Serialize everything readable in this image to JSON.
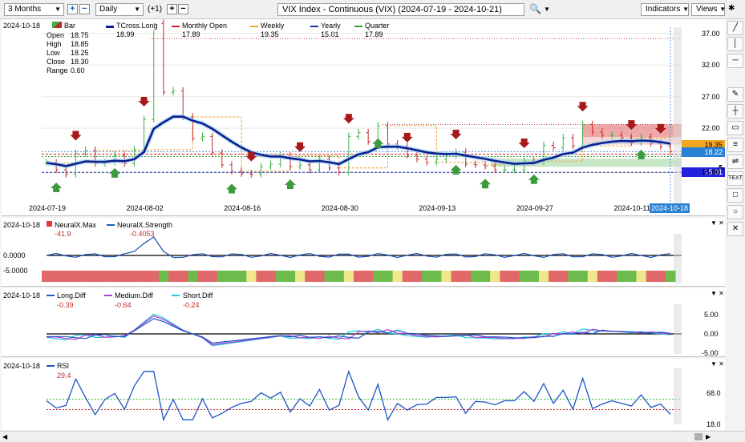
{
  "toolbar": {
    "range": "3 Months",
    "interval": "Daily",
    "plus_one": "(+1)",
    "title": "VIX Index - Continuous (VIX) (2024-07-19 - 2024-10-21)",
    "indicators_label": "Indicators",
    "views_label": "Views"
  },
  "main_panel": {
    "date": "2024-10-18",
    "bar_label": "Bar",
    "ohlc": [
      {
        "k": "Open",
        "v": "18.75"
      },
      {
        "k": "High",
        "v": "18.85"
      },
      {
        "k": "Low",
        "v": "18.25"
      },
      {
        "k": "Close",
        "v": "18.30"
      },
      {
        "k": "Range",
        "v": "0.60"
      }
    ],
    "legend": [
      {
        "name": "TCross.Long",
        "value": "18.99",
        "color": "#0a1f8f"
      },
      {
        "name": "Monthly Open",
        "value": "17.89",
        "color": "#d42020"
      },
      {
        "name": "Weekly",
        "value": "19.35",
        "color": "#f0a030"
      },
      {
        "name": "Yearly",
        "value": "15.01",
        "color": "#1a2a9a"
      },
      {
        "name": "Quarter",
        "value": "17.89",
        "color": "#30a030"
      }
    ],
    "price_ticks": [
      "37.00",
      "32.00",
      "27.00",
      "22.00",
      "15.00"
    ],
    "price_tags": [
      {
        "text": "19.35",
        "bg": "#f5a623"
      },
      {
        "text": "18.22",
        "bg": "#2a82d6"
      },
      {
        "text": "15.01",
        "bg": "#2222dd"
      }
    ],
    "dates": [
      "2024-07-19",
      "2024-08-02",
      "2024-08-16",
      "2024-08-30",
      "2024-09-13",
      "2024-09-27",
      "2024-10-11",
      "2024-10-18"
    ]
  },
  "neural_panel": {
    "date": "2024-10-18",
    "max_name": "NeuralX.Max",
    "max_value": "-41.9",
    "strength_name": "NeuralX.Strength",
    "strength_value": "-0.4053",
    "ticks": [
      "0.0000",
      "-5.0000"
    ]
  },
  "diff_panel": {
    "date": "2024-10-18",
    "long_name": "Long.Diff",
    "long_value": "-0.39",
    "medium_name": "Medium.Diff",
    "medium_value": "-0.64",
    "short_name": "Short.Diff",
    "short_value": "-0.24",
    "ticks": [
      "5.00",
      "0.00",
      "-5.00"
    ]
  },
  "rsi_panel": {
    "date": "2024-10-18",
    "name": "RSI",
    "value": "29.4",
    "ticks": [
      "68.0",
      "18.0"
    ]
  },
  "chart_data": [
    {
      "type": "candlestick",
      "title": "VIX Index - Continuous (VIX)",
      "x": [
        "2024-07-19",
        "2024-07-22",
        "2024-07-23",
        "2024-07-24",
        "2024-07-25",
        "2024-07-26",
        "2024-07-29",
        "2024-07-30",
        "2024-07-31",
        "2024-08-01",
        "2024-08-02",
        "2024-08-05",
        "2024-08-06",
        "2024-08-07",
        "2024-08-08",
        "2024-08-09",
        "2024-08-12",
        "2024-08-13",
        "2024-08-14",
        "2024-08-15",
        "2024-08-16",
        "2024-08-19",
        "2024-08-20",
        "2024-08-21",
        "2024-08-22",
        "2024-08-23",
        "2024-08-26",
        "2024-08-27",
        "2024-08-28",
        "2024-08-29",
        "2024-08-30",
        "2024-09-03",
        "2024-09-04",
        "2024-09-05",
        "2024-09-06",
        "2024-09-09",
        "2024-09-10",
        "2024-09-11",
        "2024-09-12",
        "2024-09-13",
        "2024-09-16",
        "2024-09-17",
        "2024-09-18",
        "2024-09-19",
        "2024-09-20",
        "2024-09-23",
        "2024-09-24",
        "2024-09-25",
        "2024-09-26",
        "2024-09-27",
        "2024-09-30",
        "2024-10-01",
        "2024-10-02",
        "2024-10-03",
        "2024-10-04",
        "2024-10-07",
        "2024-10-08",
        "2024-10-09",
        "2024-10-10",
        "2024-10-11",
        "2024-10-14",
        "2024-10-15",
        "2024-10-16",
        "2024-10-17",
        "2024-10-18"
      ],
      "close": [
        16.5,
        15.4,
        14.7,
        18.0,
        18.5,
        16.4,
        16.6,
        17.7,
        16.4,
        18.6,
        23.4,
        38.6,
        27.7,
        27.9,
        23.8,
        20.4,
        20.7,
        18.1,
        16.2,
        15.2,
        14.8,
        14.7,
        15.9,
        16.3,
        17.6,
        15.9,
        16.2,
        15.4,
        17.1,
        15.7,
        15.0,
        20.7,
        21.3,
        19.9,
        22.4,
        19.5,
        19.1,
        17.7,
        17.1,
        16.6,
        17.1,
        17.6,
        18.2,
        16.3,
        16.2,
        16.0,
        15.4,
        15.4,
        15.4,
        16.8,
        16.7,
        19.3,
        18.9,
        20.5,
        19.2,
        22.6,
        21.4,
        20.9,
        20.9,
        20.5,
        19.7,
        20.6,
        19.6,
        19.1,
        18.3
      ],
      "overlays": {
        "Monthly Open": 17.89,
        "Weekly": 19.35,
        "Yearly": 15.01,
        "Quarter": 17.89,
        "TCross.Long_last": 18.99
      },
      "ylim": [
        12,
        38
      ]
    },
    {
      "type": "line",
      "series": [
        {
          "name": "NeuralX.Strength",
          "last": -0.4053
        }
      ],
      "summary": {
        "NeuralX.Max": -41.9
      },
      "ylim": [
        -7,
        6
      ]
    },
    {
      "type": "line",
      "series": [
        {
          "name": "Long.Diff",
          "last": -0.39
        },
        {
          "name": "Medium.Diff",
          "last": -0.64
        },
        {
          "name": "Short.Diff",
          "last": -0.24
        }
      ],
      "ylim": [
        -5.5,
        7
      ]
    },
    {
      "type": "line",
      "series": [
        {
          "name": "RSI",
          "last": 29.4
        }
      ],
      "ylim": [
        18,
        90
      ]
    }
  ]
}
